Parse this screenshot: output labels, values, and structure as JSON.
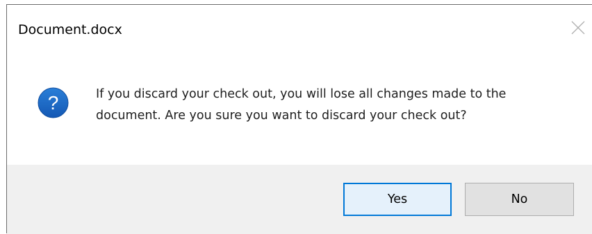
{
  "dialog": {
    "title": "Document.docx",
    "close_icon": "close-icon",
    "icon": "question-icon",
    "icon_glyph": "?",
    "icon_color": "#1565c0",
    "message": "If you discard your check out, you will lose all changes made to the document. Are you sure you want to discard your check out?",
    "buttons": {
      "yes_label": "Yes",
      "no_label": "No"
    },
    "accent_color": "#0078d7"
  }
}
